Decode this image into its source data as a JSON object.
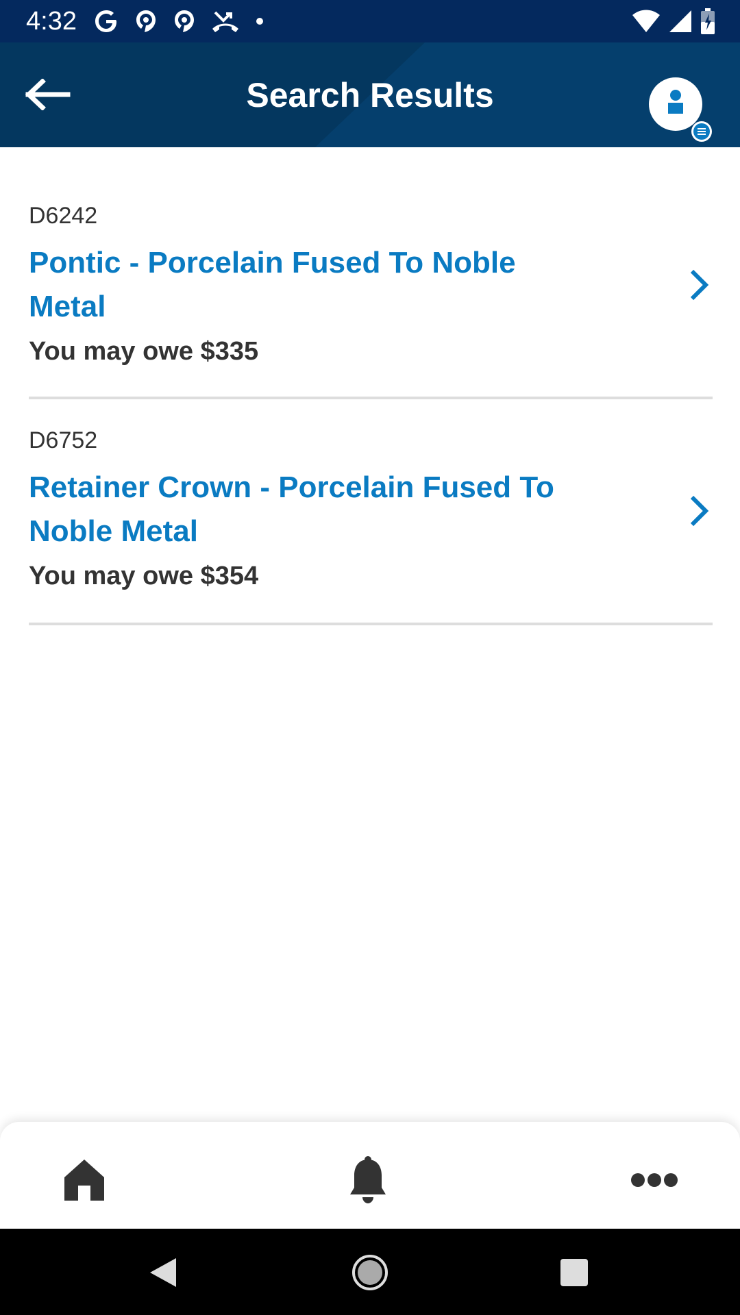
{
  "status_bar": {
    "time": "4:32",
    "left_icons": [
      "google-icon",
      "podcast-icon",
      "podcast-icon",
      "missed-call-icon",
      "dot-icon"
    ],
    "right_icons": [
      "wifi-icon",
      "signal-icon",
      "battery-icon"
    ]
  },
  "header": {
    "title": "Search Results",
    "back_icon": "arrow-left-icon",
    "profile_icon": "user-profile-icon",
    "colors": {
      "background": "#053f6d",
      "status_bar": "#04295e"
    }
  },
  "results": [
    {
      "code": "D6242",
      "name": "Pontic - Porcelain Fused To Noble Metal",
      "name_lines": [
        "Pontic - Porcelain Fused To Noble",
        "Metal"
      ],
      "owe": "You may owe $335"
    },
    {
      "code": "D6752",
      "name": "Retainer Crown - Porcelain Fused To Noble Metal",
      "name_lines": [
        "Retainer Crown - Porcelain Fused To",
        "Noble Metal"
      ],
      "owe": "You may owe $354"
    }
  ],
  "accent_color": "#0a7bc2",
  "bottom_nav": {
    "items": [
      "home-icon",
      "bell-icon",
      "more-icon"
    ]
  },
  "system_nav": {
    "items": [
      "back-triangle-icon",
      "home-circle-icon",
      "recents-square-icon"
    ]
  }
}
